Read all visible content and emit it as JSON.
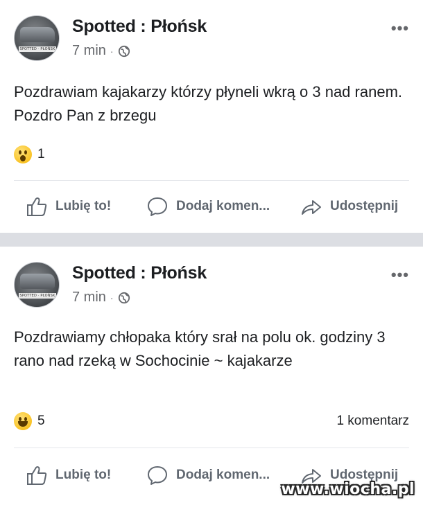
{
  "posts": [
    {
      "page_name": "Spotted : Płońsk",
      "time": "7 min",
      "separator": "·",
      "avatar_plate": "SPOTTED · PŁOŃSK",
      "more_label": "•••",
      "text": "Pozdrawiam kajakarzy którzy płyneli wkrą o 3 nad ranem. Pozdro Pan z brzegu",
      "reaction": {
        "type": "wow",
        "count": "1"
      },
      "comments": "",
      "actions": {
        "like": "Lubię to!",
        "comment": "Dodaj komen...",
        "share": "Udostępnij"
      }
    },
    {
      "page_name": "Spotted : Płońsk",
      "time": "7 min",
      "separator": "·",
      "avatar_plate": "SPOTTED · PŁOŃSK",
      "more_label": "•••",
      "text": "Pozdrawiamy chłopaka który srał na polu ok. godziny 3 rano nad rzeką w Sochocinie ~ kajakarze",
      "reaction": {
        "type": "haha",
        "count": "5"
      },
      "comments": "1 komentarz",
      "actions": {
        "like": "Lubię to!",
        "comment": "Dodaj komen...",
        "share": "Udostępnij"
      }
    }
  ],
  "watermark": "www.wiocha.pl",
  "colors": {
    "page_bg": "#dcdee3",
    "card_bg": "#ffffff",
    "text": "#1c1e21",
    "secondary": "#65676b",
    "action": "#606770"
  }
}
